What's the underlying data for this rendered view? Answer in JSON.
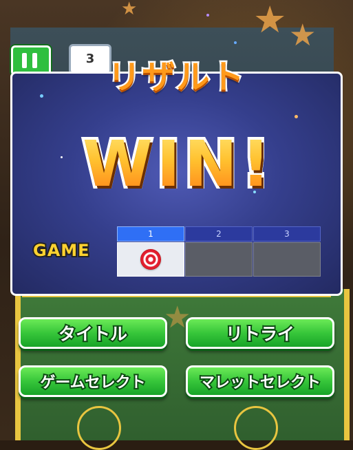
{
  "header": {
    "title": "リザルト"
  },
  "result": {
    "outcome": "WIN!"
  },
  "hud": {
    "score_chip": "3"
  },
  "games": {
    "label": "GAME",
    "columns": [
      {
        "number": "1",
        "state": "won"
      },
      {
        "number": "2",
        "state": "unplayed"
      },
      {
        "number": "3",
        "state": "unplayed"
      }
    ]
  },
  "buttons": {
    "title": "タイトル",
    "retry": "リトライ",
    "game_select": "ゲームセレクト",
    "mallet_select": "マレットセレクト"
  },
  "colors": {
    "panel": "#353f8d",
    "win_text": "#ffb42a",
    "button_green": "#37c63a",
    "active_column": "#2f6ff5",
    "game_label": "#ffd230"
  }
}
